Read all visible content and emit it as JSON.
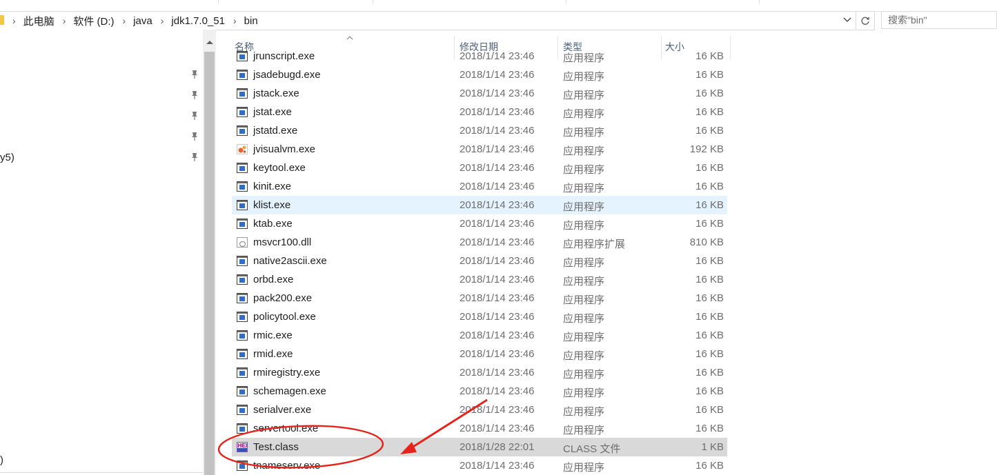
{
  "address": {
    "crumbs": [
      "此电脑",
      "软件 (D:)",
      "java",
      "jdk1.7.0_51",
      "bin"
    ]
  },
  "search": {
    "placeholder": "搜索\"bin\""
  },
  "nav": {
    "partial_labels": [
      "y5)",
      ")"
    ]
  },
  "columns": {
    "name": "名称",
    "date": "修改日期",
    "type": "类型",
    "size": "大小"
  },
  "files": [
    {
      "name": "jrunscript.exe",
      "date": "2018/1/14 23:46",
      "type": "应用程序",
      "size": "16 KB",
      "icon": "exe-icon"
    },
    {
      "name": "jsadebugd.exe",
      "date": "2018/1/14 23:46",
      "type": "应用程序",
      "size": "16 KB",
      "icon": "exe-icon"
    },
    {
      "name": "jstack.exe",
      "date": "2018/1/14 23:46",
      "type": "应用程序",
      "size": "16 KB",
      "icon": "exe-icon"
    },
    {
      "name": "jstat.exe",
      "date": "2018/1/14 23:46",
      "type": "应用程序",
      "size": "16 KB",
      "icon": "exe-icon"
    },
    {
      "name": "jstatd.exe",
      "date": "2018/1/14 23:46",
      "type": "应用程序",
      "size": "16 KB",
      "icon": "exe-icon"
    },
    {
      "name": "jvisualvm.exe",
      "date": "2018/1/14 23:46",
      "type": "应用程序",
      "size": "192 KB",
      "icon": "visualvm-icon"
    },
    {
      "name": "keytool.exe",
      "date": "2018/1/14 23:46",
      "type": "应用程序",
      "size": "16 KB",
      "icon": "exe-icon"
    },
    {
      "name": "kinit.exe",
      "date": "2018/1/14 23:46",
      "type": "应用程序",
      "size": "16 KB",
      "icon": "exe-icon"
    },
    {
      "name": "klist.exe",
      "date": "2018/1/14 23:46",
      "type": "应用程序",
      "size": "16 KB",
      "icon": "exe-icon",
      "state": "hover"
    },
    {
      "name": "ktab.exe",
      "date": "2018/1/14 23:46",
      "type": "应用程序",
      "size": "16 KB",
      "icon": "exe-icon"
    },
    {
      "name": "msvcr100.dll",
      "date": "2018/1/14 23:46",
      "type": "应用程序扩展",
      "size": "810 KB",
      "icon": "dll-icon"
    },
    {
      "name": "native2ascii.exe",
      "date": "2018/1/14 23:46",
      "type": "应用程序",
      "size": "16 KB",
      "icon": "exe-icon"
    },
    {
      "name": "orbd.exe",
      "date": "2018/1/14 23:46",
      "type": "应用程序",
      "size": "16 KB",
      "icon": "exe-icon"
    },
    {
      "name": "pack200.exe",
      "date": "2018/1/14 23:46",
      "type": "应用程序",
      "size": "16 KB",
      "icon": "exe-icon"
    },
    {
      "name": "policytool.exe",
      "date": "2018/1/14 23:46",
      "type": "应用程序",
      "size": "16 KB",
      "icon": "exe-icon"
    },
    {
      "name": "rmic.exe",
      "date": "2018/1/14 23:46",
      "type": "应用程序",
      "size": "16 KB",
      "icon": "exe-icon"
    },
    {
      "name": "rmid.exe",
      "date": "2018/1/14 23:46",
      "type": "应用程序",
      "size": "16 KB",
      "icon": "exe-icon"
    },
    {
      "name": "rmiregistry.exe",
      "date": "2018/1/14 23:46",
      "type": "应用程序",
      "size": "16 KB",
      "icon": "exe-icon"
    },
    {
      "name": "schemagen.exe",
      "date": "2018/1/14 23:46",
      "type": "应用程序",
      "size": "16 KB",
      "icon": "exe-icon"
    },
    {
      "name": "serialver.exe",
      "date": "2018/1/14 23:46",
      "type": "应用程序",
      "size": "16 KB",
      "icon": "exe-icon"
    },
    {
      "name": "servertool.exe",
      "date": "2018/1/14 23:46",
      "type": "应用程序",
      "size": "16 KB",
      "icon": "exe-icon"
    },
    {
      "name": "Test.class",
      "date": "2018/1/28 22:01",
      "type": "CLASS 文件",
      "size": "1 KB",
      "icon": "hex-icon",
      "state": "selected"
    },
    {
      "name": "tnameserv.exe",
      "date": "2018/1/14 23:46",
      "type": "应用程序",
      "size": "16 KB",
      "icon": "exe-icon"
    }
  ],
  "hex_icon_text": "HEX",
  "colors": {
    "hover_row": "#e5f3ff",
    "selected_row": "#d9d9d9",
    "annotation": "#e5231b"
  }
}
